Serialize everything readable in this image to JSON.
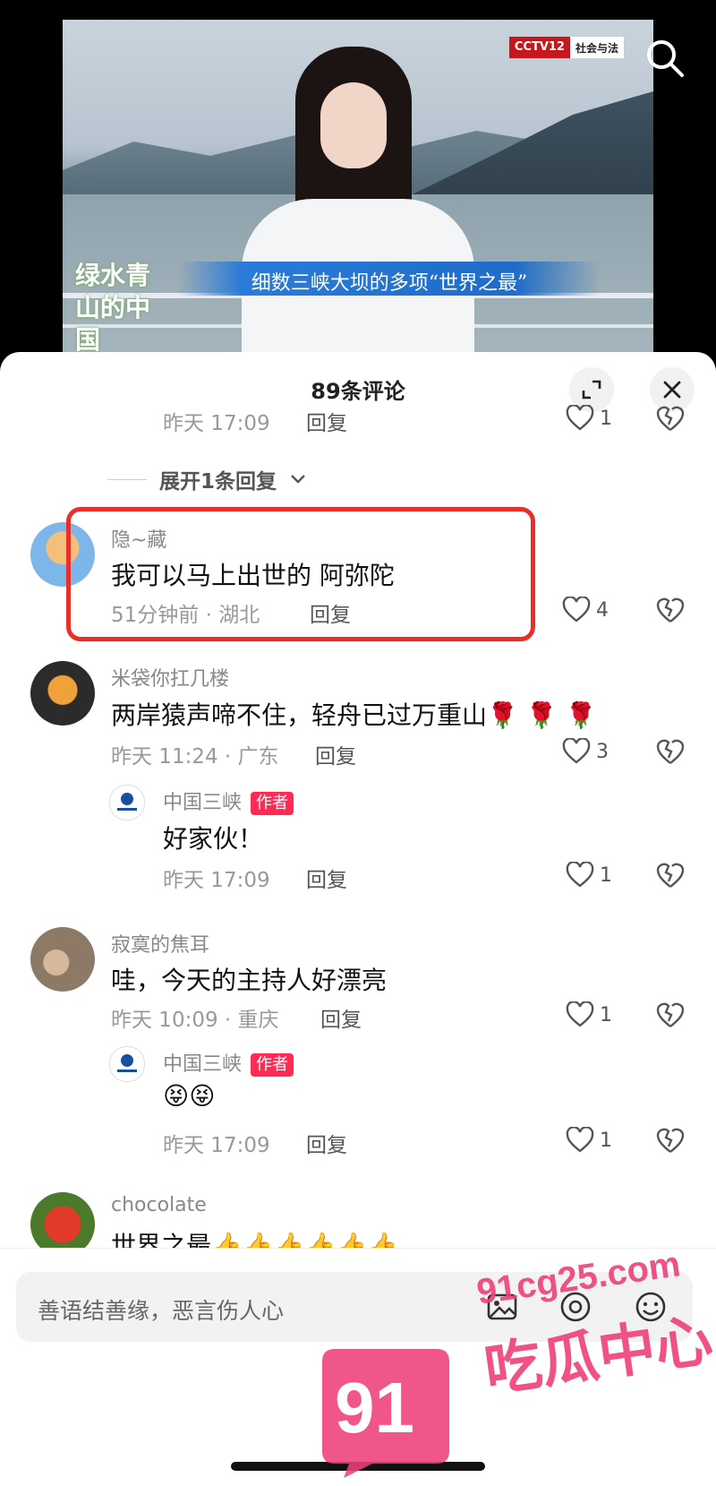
{
  "video": {
    "channel_logo": "CCTV12",
    "channel_name": "社会与法",
    "program_logo": "绿水青山的中国",
    "banner": "细数三峡大坝的多项“世界之最”"
  },
  "sheet": {
    "title": "89条评论"
  },
  "comments": [
    {
      "time": "昨天 17:09",
      "reply": "回复",
      "likes": "1"
    },
    {
      "expand": "展开1条回复"
    },
    {
      "user": "隐~藏",
      "text": "我可以马上出世的 阿弥陀",
      "meta": "51分钟前 · 湖北",
      "reply": "回复",
      "likes": "4"
    },
    {
      "user": "米袋你扛几楼",
      "text": "两岸猿声啼不住，轻舟已过万重山🌹 🌹 🌹",
      "meta": "昨天 11:24 · 广东",
      "reply": "回复",
      "likes": "3"
    },
    {
      "user": "中国三峡",
      "tag": "作者",
      "text": "好家伙！",
      "meta": "昨天 17:09",
      "reply": "回复",
      "likes": "1"
    },
    {
      "user": "寂寞的焦耳",
      "text": "哇，今天的主持人好漂亮",
      "meta": "昨天 10:09 · 重庆",
      "reply": "回复",
      "likes": "1"
    },
    {
      "user": "中国三峡",
      "tag": "作者",
      "text": "😝😝",
      "meta": "昨天 17:09",
      "reply": "回复",
      "likes": "1"
    },
    {
      "user": "chocolate",
      "text": "世界之最👍👍👍👍👍👍"
    }
  ],
  "input": {
    "placeholder": "善语结善缘，恶言伤人心"
  },
  "watermark": {
    "number": "91",
    "domain": "91cg25.com",
    "label": "吃瓜中心"
  },
  "colors": {
    "accent": "#fe2c55",
    "highlight": "#e8302a"
  }
}
